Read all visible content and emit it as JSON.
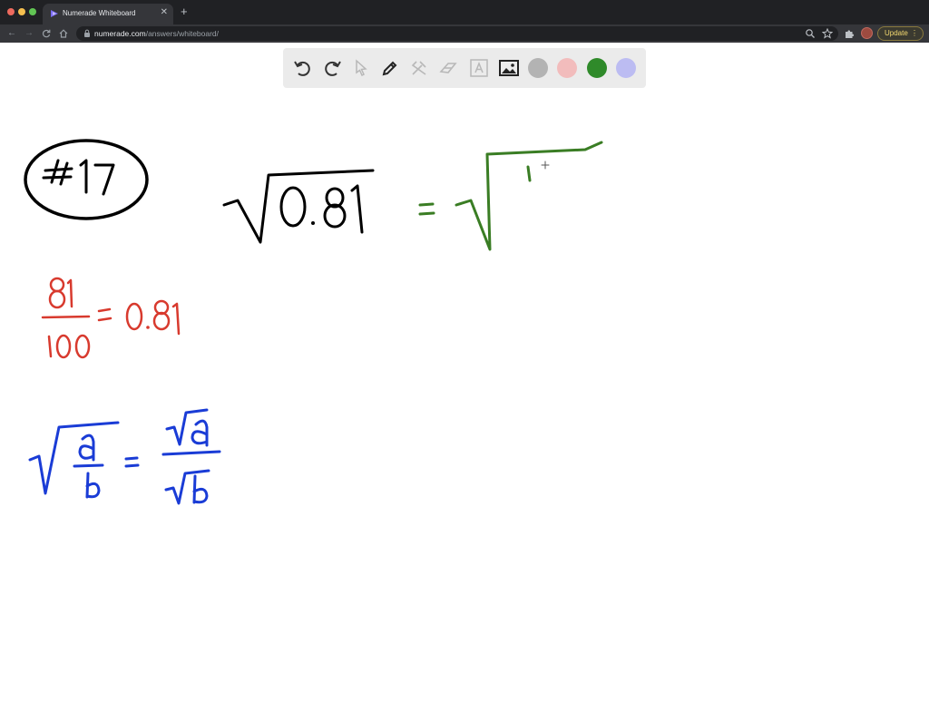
{
  "browser": {
    "tab_title": "Numerade Whiteboard",
    "url_host": "numerade.com",
    "url_path": "/answers/whiteboard/",
    "update_label": "Update"
  },
  "whiteboard": {
    "tools": [
      "undo-icon",
      "redo-icon",
      "select-icon",
      "pen-icon",
      "tools-icon",
      "eraser-icon",
      "text-icon",
      "image-icon"
    ],
    "colors": [
      "#b3b3b3",
      "#f2bcbc",
      "#2f8a2a",
      "#bcbcf2"
    ],
    "selected_color": "#2f8a2a",
    "ink": {
      "black": "#000000",
      "red": "#d83a2e",
      "green": "#3a7d24",
      "blue": "#1a3cd6"
    },
    "content": {
      "problem_number": "#17",
      "main_radicand": "0.81",
      "equals": "=",
      "green_partial": "1",
      "fraction_numerator": "81",
      "fraction_denominator": "100",
      "fraction_result": "0.81",
      "rule_numerator": "a",
      "rule_denominator": "b"
    }
  }
}
